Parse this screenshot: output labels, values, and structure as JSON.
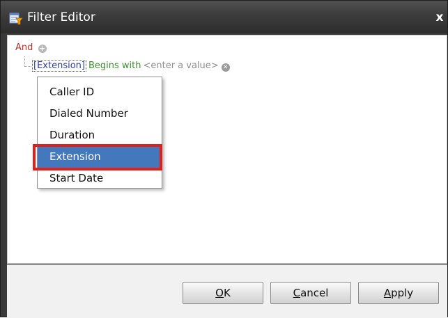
{
  "window": {
    "title": "Filter Editor",
    "close_label": "x"
  },
  "filter": {
    "group_operator": "And",
    "condition": {
      "field": "[Extension]",
      "operator": "Begins with",
      "value_placeholder": "<enter a value>"
    }
  },
  "field_dropdown": {
    "items": [
      "Caller ID",
      "Dialed Number",
      "Duration",
      "Extension",
      "Start Date"
    ],
    "selected": "Extension"
  },
  "buttons": {
    "ok": {
      "mnemonic": "O",
      "rest": "K"
    },
    "cancel": {
      "mnemonic": "C",
      "rest": "ancel"
    },
    "apply": {
      "mnemonic": "A",
      "rest": "pply"
    }
  },
  "colors": {
    "titlebar": "#3c3c3c",
    "group_operator": "#c0302b",
    "field": "#2c3f95",
    "operator": "#3f8c32",
    "selected_item": "#4478bd",
    "highlight_box": "#e0201b"
  }
}
